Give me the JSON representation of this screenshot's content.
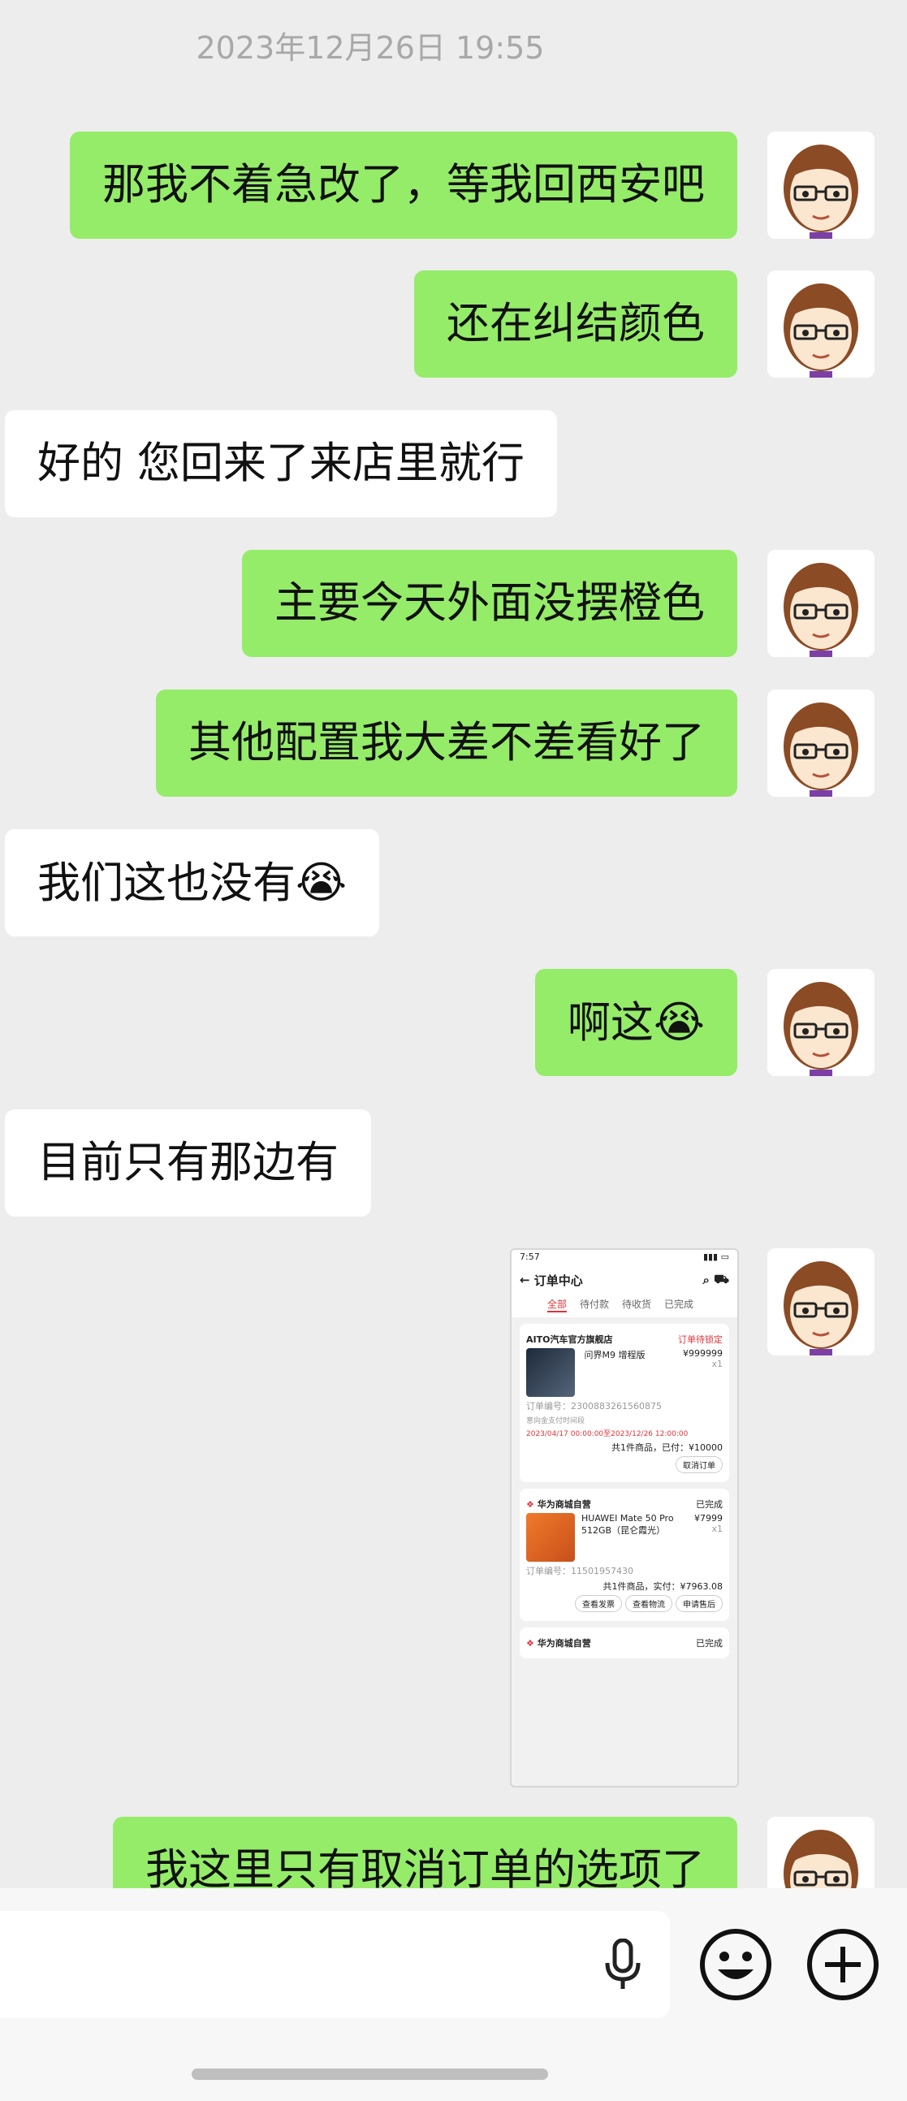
{
  "chat": {
    "timestamp": "2023年12月26日 19:55",
    "messages": [
      {
        "side": "out",
        "text": "那我不着急改了，等我回西安吧"
      },
      {
        "side": "out",
        "text": "还在纠结颜色"
      },
      {
        "side": "in",
        "text": "好的 您回来了来店里就行"
      },
      {
        "side": "out",
        "text": "主要今天外面没摆橙色"
      },
      {
        "side": "out",
        "text": "其他配置我大差不差看好了"
      },
      {
        "side": "in",
        "text": "我们这也没有",
        "emoji": "😭"
      },
      {
        "side": "out",
        "text": "啊这",
        "emoji": "😭"
      },
      {
        "side": "in",
        "text": "目前只有那边有"
      },
      {
        "side": "out",
        "text": "我这里只有取消订单的选项了"
      }
    ]
  },
  "screenshot": {
    "time": "7:57",
    "title": "订单中心",
    "tabs": [
      "全部",
      "待付款",
      "待收货",
      "已完成"
    ],
    "order1": {
      "store": "AITO汽车官方旗舰店",
      "status": "订单待锁定",
      "product": "问界M9 增程版",
      "price": "¥999999",
      "qty": "x1",
      "order_no_label": "订单编号：",
      "order_no": "2300883261560875",
      "pay_window_label": "意向金支付时间段",
      "pay_window": "2023/04/17 00:00:00至2023/12/26 12:00:00",
      "summary": "共1件商品，已付：¥10000",
      "cancel": "取消订单"
    },
    "order2": {
      "store": "华为商城自营",
      "status": "已完成",
      "product": "HUAWEI Mate 50 Pro 512GB（昆仑霞光）",
      "price": "¥7999",
      "qty": "x1",
      "order_no_label": "订单编号：",
      "order_no": "11501957430",
      "summary": "共1件商品，实付：¥7963.08",
      "buttons": [
        "查看发票",
        "查看物流",
        "申请售后"
      ]
    },
    "order3": {
      "store": "华为商城自营",
      "status": "已完成"
    }
  },
  "icons": {
    "mic": "microphone-icon",
    "emoji": "smiley-icon",
    "plus": "plus-circle-icon"
  },
  "colors": {
    "outgoing": "#95ec69",
    "incoming": "#ffffff",
    "background": "#ededed"
  }
}
